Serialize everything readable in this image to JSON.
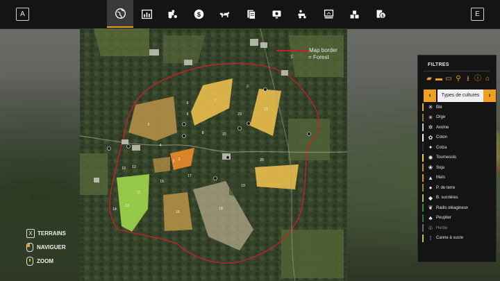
{
  "topbar": {
    "left_key": "A",
    "right_key": "E",
    "tabs": [
      {
        "name": "globe-icon",
        "active": true
      },
      {
        "name": "statistics-icon",
        "active": false
      },
      {
        "name": "tractor-icon",
        "active": false
      },
      {
        "name": "finances-icon",
        "active": false
      },
      {
        "name": "animals-icon",
        "active": false
      },
      {
        "name": "contracts-icon",
        "active": false
      },
      {
        "name": "production-icon",
        "active": false
      },
      {
        "name": "vehicles-icon",
        "active": false
      },
      {
        "name": "garage-icon",
        "active": false
      },
      {
        "name": "stock-icon",
        "active": false
      },
      {
        "name": "prices-icon",
        "active": false
      }
    ]
  },
  "map": {
    "legend": {
      "border_label": "Map border",
      "forest_symbol": "F",
      "forest_label": "= Forest"
    },
    "forest_marker": "F",
    "field_numbers": [
      "2",
      "3",
      "4",
      "5",
      "6",
      "7",
      "8",
      "9",
      "10",
      "11",
      "12",
      "13",
      "14",
      "15",
      "16",
      "17",
      "18",
      "19",
      "20",
      "21",
      "22",
      "23"
    ]
  },
  "help": {
    "terrains_key": "X",
    "terrains_label": "TERRAINS",
    "naviguer_label": "NAVIGUER",
    "zoom_label": "ZOOM"
  },
  "filters": {
    "title": "FILTRES",
    "filter_icons": [
      "tractor-icon",
      "combine-icon",
      "trailer-icon",
      "tool-icon",
      "download-icon",
      "alert-icon",
      "home-icon"
    ],
    "crop_type_label": "Types de cultures",
    "prev_arrow": "‹",
    "next_arrow": "›",
    "crops": [
      {
        "label": "Blé",
        "color": "#d9b13a",
        "icon": "wheat-icon"
      },
      {
        "label": "Orge",
        "color": "#8e7a38",
        "icon": "barley-icon"
      },
      {
        "label": "Avoine",
        "color": "#c9c9c9",
        "icon": "oat-icon"
      },
      {
        "label": "Coton",
        "color": "#ffffff",
        "icon": "cotton-icon"
      },
      {
        "label": "Colza",
        "color": "#2f2f2f",
        "icon": "canola-icon"
      },
      {
        "label": "Tournesols",
        "color": "#e8d640",
        "icon": "sunflower-icon"
      },
      {
        "label": "Soja",
        "color": "#b5913b",
        "icon": "soybean-icon"
      },
      {
        "label": "Maïs",
        "color": "#e88a2a",
        "icon": "corn-icon"
      },
      {
        "label": "P. de terre",
        "color": "#a0814a",
        "icon": "potato-icon"
      },
      {
        "label": "B. sucrières",
        "color": "#b9b08a",
        "icon": "sugarbeet-icon"
      },
      {
        "label": "Radis oléagineux",
        "color": "#3d8a3a",
        "icon": "radish-icon"
      },
      {
        "label": "Peuplier",
        "color": "#3a6e38",
        "icon": "poplar-icon"
      },
      {
        "label": "Herbe",
        "color": "#6a6a6a",
        "icon": "grass-icon",
        "dim": true
      },
      {
        "label": "Canne à sucre",
        "color": "#a6d06a",
        "icon": "sugarcane-icon"
      }
    ]
  }
}
